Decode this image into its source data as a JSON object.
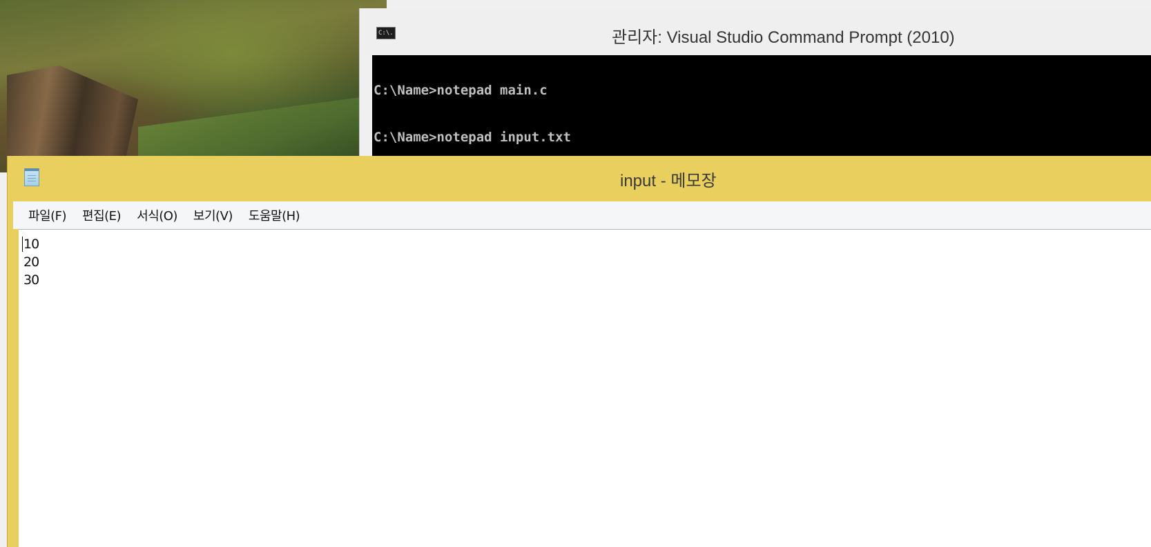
{
  "cmd": {
    "icon_text": "C:\\.",
    "title": "관리자: Visual Studio Command Prompt (2010)",
    "lines": [
      "C:\\Name>notepad main.c",
      "C:\\Name>notepad input.txt"
    ]
  },
  "notepad": {
    "title": "input - 메모장",
    "menu": [
      "파일(F)",
      "편집(E)",
      "서식(O)",
      "보기(V)",
      "도움말(H)"
    ],
    "lines": [
      "10",
      "20",
      "30"
    ]
  },
  "colors": {
    "notepad_titlebar": "#e9cf5e",
    "cmd_background": "#000000",
    "cmd_text": "#c0c0c0"
  }
}
